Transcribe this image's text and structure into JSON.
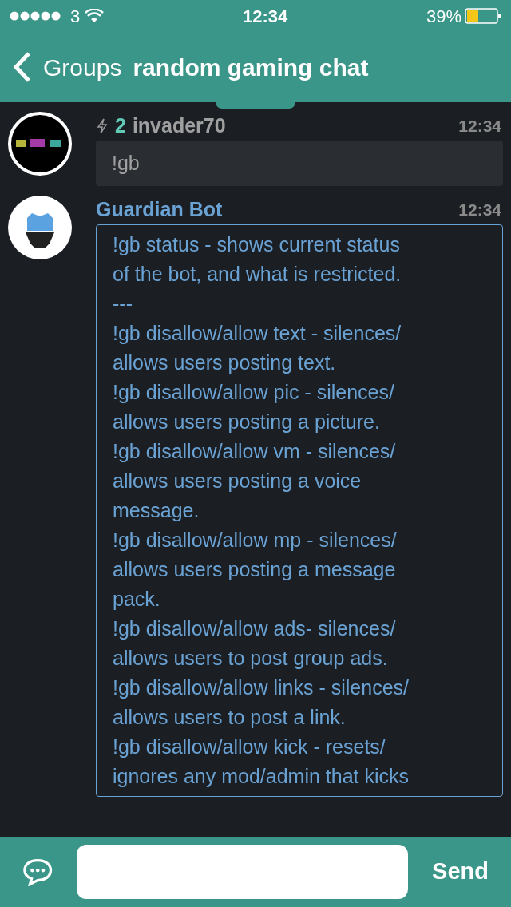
{
  "status_bar": {
    "carrier": "3",
    "time": "12:34",
    "battery": "39%"
  },
  "nav": {
    "back": "Groups",
    "title": "random gaming chat"
  },
  "messages": [
    {
      "sender": "invader70",
      "rank": "2",
      "time": "12:34",
      "kind": "user",
      "lines": [
        "!gb"
      ]
    },
    {
      "sender": "Guardian Bot",
      "time": "12:34",
      "kind": "bot",
      "lines": [
        "!gb status - shows current status",
        "of the bot, and what is restricted.",
        "---",
        "!gb disallow/allow text - silences/",
        "allows users posting text.",
        "!gb disallow/allow pic - silences/",
        "allows users posting a picture.",
        "!gb disallow/allow vm - silences/",
        "allows users posting a voice",
        "message.",
        "!gb disallow/allow mp - silences/",
        "allows users posting a message",
        "pack.",
        "!gb disallow/allow ads- silences/",
        "allows users to post group ads.",
        "!gb disallow/allow links - silences/",
        "allows users to post a link.",
        "!gb disallow/allow kick - resets/",
        "ignores any mod/admin that kicks"
      ]
    }
  ],
  "composer": {
    "send": "Send"
  }
}
